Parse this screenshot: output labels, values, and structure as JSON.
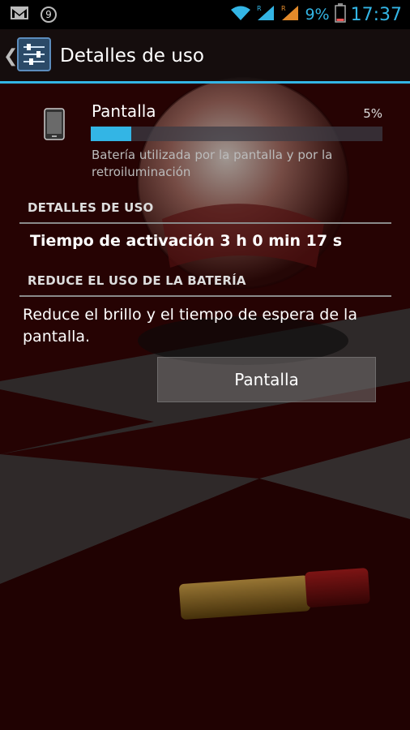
{
  "status_bar": {
    "notification_count": "9",
    "battery_percent": "9%",
    "time": "17:37",
    "icons": [
      "gmail-icon",
      "wifi-icon",
      "signal-icon",
      "battery-icon"
    ]
  },
  "action_bar": {
    "title": "Detalles de uso",
    "icon": "settings-sliders-icon"
  },
  "app_entry": {
    "name": "Pantalla",
    "percent": "5%",
    "usage_fraction": 0.14,
    "description": "Batería utilizada por la pantalla y por la retroiluminación",
    "icon": "phone-icon"
  },
  "sections": {
    "usage_details_header": "DETALLES DE USO",
    "usage_details_value": "Tiempo de activación 3 h 0 min 17 s",
    "reduce_header": "REDUCE EL USO DE LA BATERÍA",
    "reduce_text": "Reduce el brillo y el tiempo de espera de la pantalla."
  },
  "action_button": {
    "label": "Pantalla"
  },
  "colors": {
    "accent": "#33b5e5",
    "background": "#1a0000"
  }
}
